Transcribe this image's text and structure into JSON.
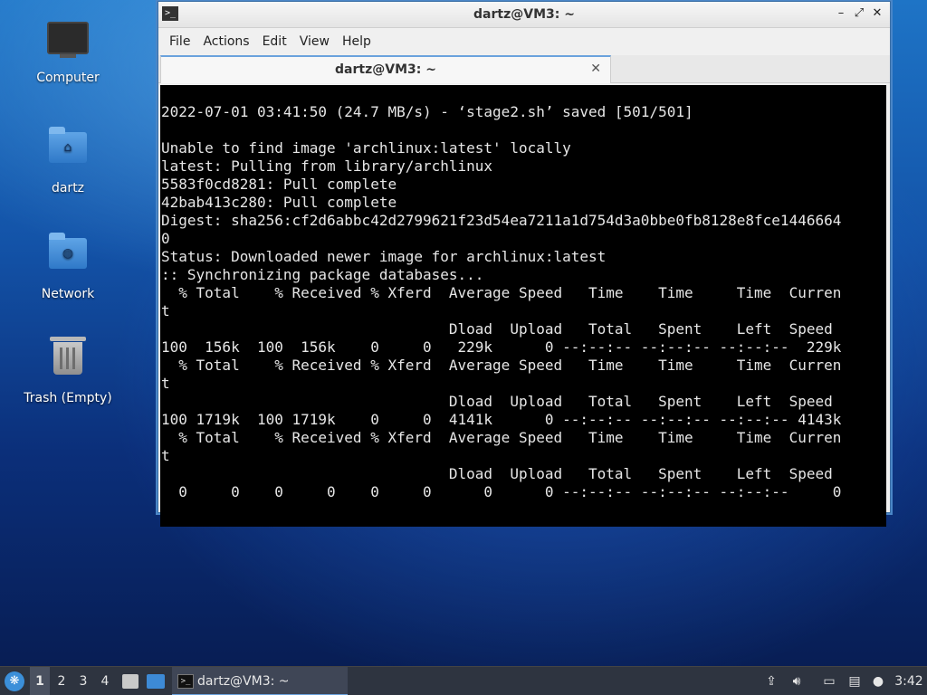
{
  "desktop": {
    "icons": [
      {
        "label": "Computer",
        "icon": "computer-icon"
      },
      {
        "label": "dartz",
        "icon": "home-folder-icon"
      },
      {
        "label": "Network",
        "icon": "network-folder-icon"
      },
      {
        "label": "Trash (Empty)",
        "icon": "trash-icon"
      }
    ]
  },
  "window": {
    "title": "dartz@VM3: ~",
    "controls": {
      "minimize": "–",
      "maximize": "⤢",
      "close": "✕"
    },
    "menu": [
      "File",
      "Actions",
      "Edit",
      "View",
      "Help"
    ],
    "tab": {
      "label": "dartz@VM3: ~",
      "close": "✕"
    },
    "terminal_lines": [
      "2022-07-01 03:41:50 (24.7 MB/s) - ‘stage2.sh’ saved [501/501]",
      "",
      "Unable to find image 'archlinux:latest' locally",
      "latest: Pulling from library/archlinux",
      "5583f0cd8281: Pull complete",
      "42bab413c280: Pull complete",
      "Digest: sha256:cf2d6abbc42d2799621f23d54ea7211a1d754d3a0bbe0fb8128e8fce1446664",
      "0",
      "Status: Downloaded newer image for archlinux:latest",
      ":: Synchronizing package databases...",
      "  % Total    % Received % Xferd  Average Speed   Time    Time     Time  Curren",
      "t",
      "                                 Dload  Upload   Total   Spent    Left  Speed",
      "100  156k  100  156k    0     0   229k      0 --:--:-- --:--:-- --:--:--  229k",
      "  % Total    % Received % Xferd  Average Speed   Time    Time     Time  Curren",
      "t",
      "                                 Dload  Upload   Total   Spent    Left  Speed",
      "100 1719k  100 1719k    0     0  4141k      0 --:--:-- --:--:-- --:--:-- 4143k",
      "  % Total    % Received % Xferd  Average Speed   Time    Time     Time  Curren",
      "t",
      "                                 Dload  Upload   Total   Spent    Left  Speed",
      "  0     0    0     0    0     0      0      0 --:--:-- --:--:-- --:--:--     0"
    ]
  },
  "taskbar": {
    "workspaces": [
      "1",
      "2",
      "3",
      "4"
    ],
    "active_workspace": "1",
    "task_button": "dartz@VM3: ~",
    "clock": "3:42"
  },
  "colors": {
    "accent": "#6aa2dd",
    "terminal_bg": "#000000",
    "terminal_fg": "#e6e6e6",
    "taskbar_bg": "#2e3440"
  }
}
